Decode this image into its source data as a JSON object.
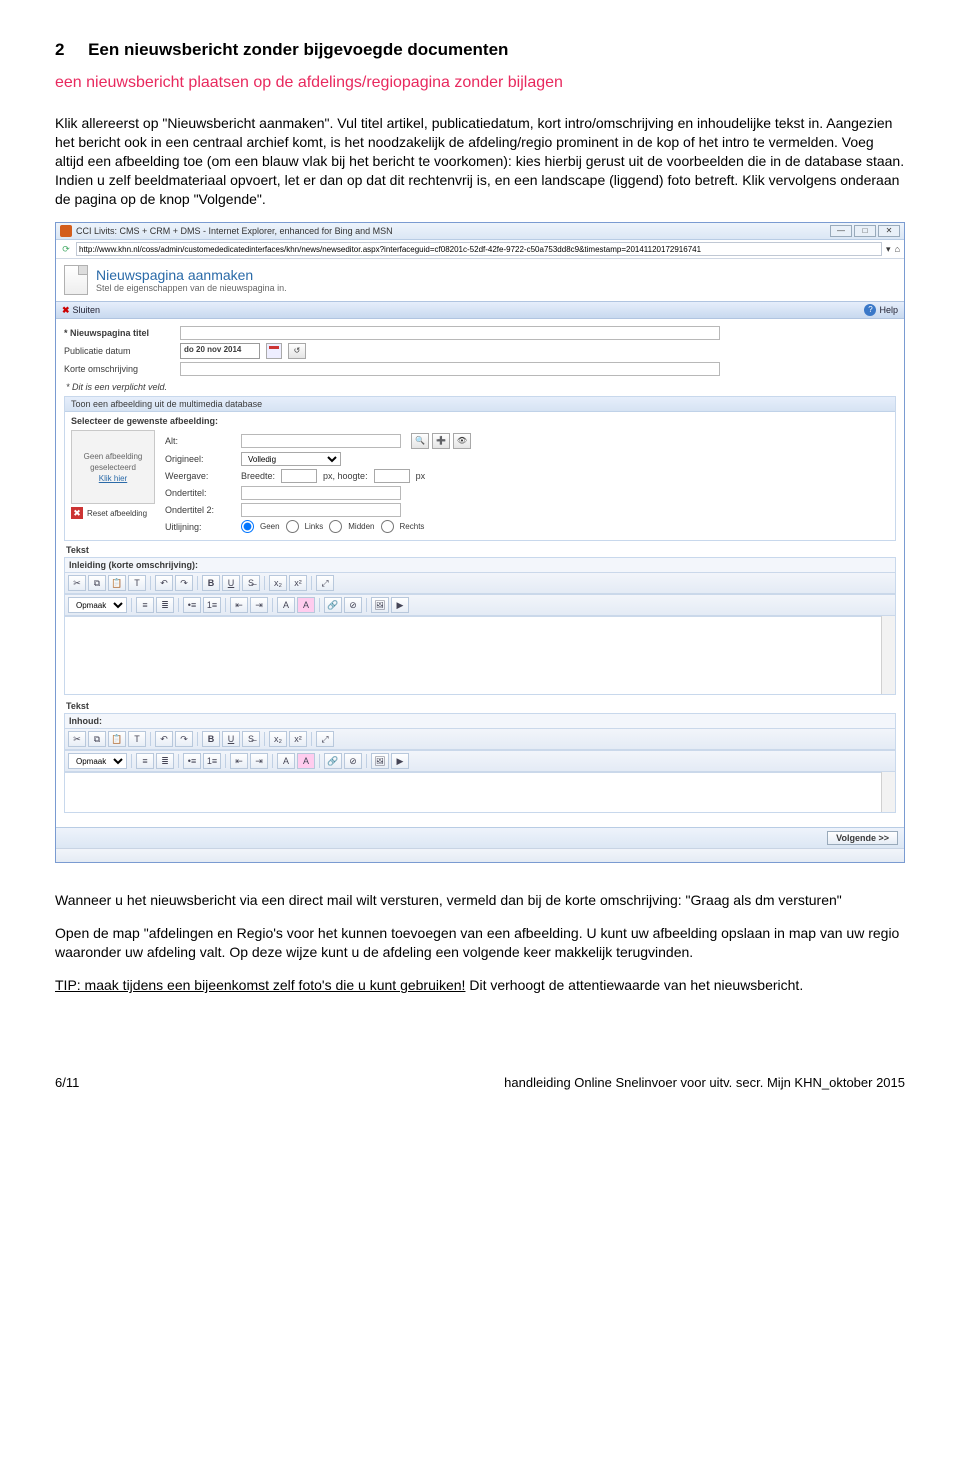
{
  "heading_num": "2",
  "heading_text": "Een nieuwsbericht  zonder bijgevoegde documenten",
  "subtitle": "een nieuwsbericht plaatsen op de afdelings/regiopagina zonder bijlagen",
  "para1": "Klik allereerst op \"Nieuwsbericht aanmaken\". Vul titel artikel, publicatiedatum, kort intro/omschrijving en inhoudelijke tekst in. Aangezien het bericht ook in een centraal archief komt, is het noodzakelijk de afdeling/regio prominent in de kop of het intro te vermelden. Voeg altijd een afbeelding toe (om een blauw vlak bij het bericht te voorkomen): kies hierbij gerust uit de voorbeelden die in de database staan. Indien u zelf beeldmateriaal opvoert, let er dan op dat dit rechtenvrij is, en een landscape (liggend) foto betreft. Klik vervolgens onderaan de pagina op de knop \"Volgende\".",
  "win": {
    "title": "CCI Livits: CMS + CRM + DMS - Internet Explorer, enhanced for Bing and MSN",
    "url": "http://www.khn.nl/coss/admin/customededicatedinterfaces/khn/news/newseditor.aspx?interfaceguid=cf08201c-52df-42fe-9722-c50a753dd8c9&timestamp=20141120172916741",
    "page_title": "Nieuwspagina aanmaken",
    "page_sub": "Stel de eigenschappen van de nieuwspagina in.",
    "close": "Sluiten",
    "help": "Help",
    "f_title": "* Nieuwspagina titel",
    "f_date": "Publicatie datum",
    "f_date_val": "do 20 nov 2014",
    "f_sum": "Korte omschrijving",
    "req": "* Dit is een verplicht veld.",
    "grp_img": "Toon een afbeelding uit de multimedia database",
    "grp_img_sub": "Selecteer de gewenste afbeelding:",
    "thumb1": "Geen afbeelding",
    "thumb2": "geselecteerd",
    "thumb3": "Klik hier",
    "reset": "Reset afbeelding",
    "alt": "Alt:",
    "orig": "Origineel:",
    "orig_val": "Volledig",
    "weerg": "Weergave:",
    "breedte": "Breedte:",
    "px_h": "px, hoogte:",
    "px": "px",
    "ot1": "Ondertitel:",
    "ot2": "Ondertitel 2:",
    "uitl": "Uitlijning:",
    "r_geen": "Geen",
    "r_links": "Links",
    "r_midden": "Midden",
    "r_rechts": "Rechts",
    "tekst": "Tekst",
    "ed1_label": "Inleiding (korte omschrijving):",
    "ed2_label": "Inhoud:",
    "opmaak": "Opmaak",
    "volgende": "Volgende >>"
  },
  "para2a": "Wanneer u  het nieuwsbericht via een direct mail wilt versturen, vermeld dan bij de korte omschrijving: \"Graag als dm versturen\"",
  "para3": "Open de map \"afdelingen en Regio's voor het kunnen toevoegen van een afbeelding. U kunt uw afbeelding opslaan in map van uw regio waaronder uw afdeling valt. Op deze wijze kunt u de afdeling een volgende keer makkelijk terugvinden.",
  "para4_pre": "TIP: maak tijdens een bijeenkomst zelf foto's die u kunt gebruiken!",
  "para4_post": " Dit verhoogt de attentiewaarde van het nieuwsbericht.",
  "footer_left": "6/11",
  "footer_right": "handleiding Online Snelinvoer voor uitv. secr. Mijn KHN_oktober 2015"
}
